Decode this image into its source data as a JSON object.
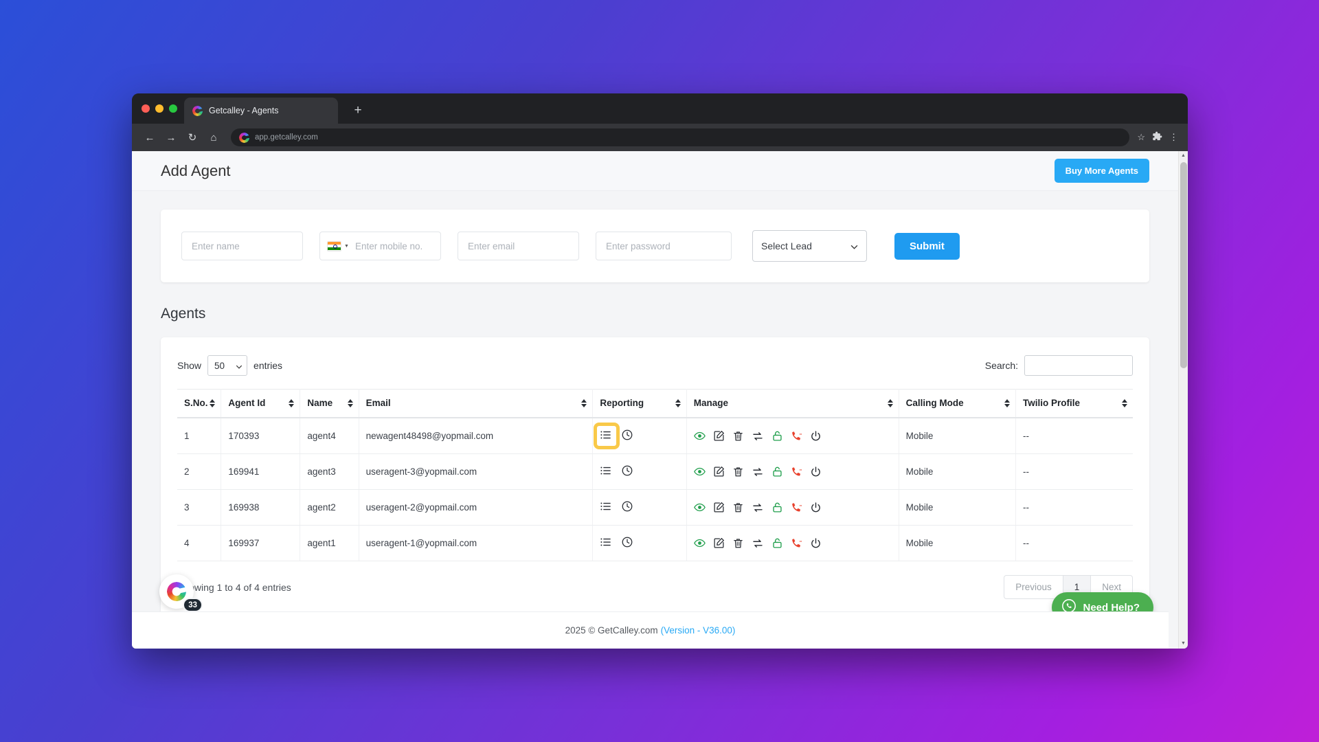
{
  "browser": {
    "tab_title": "Getcalley - Agents",
    "new_tab_label": "+",
    "url": "app.getcalley.com",
    "nav": {
      "back": "←",
      "forward": "→",
      "reload": "↻",
      "home": "⌂"
    },
    "toolbar_right": {
      "bookmark": "☆",
      "extensions": "puzzle-icon",
      "menu": "⋮"
    }
  },
  "header": {
    "title": "Add Agent",
    "buy_more_agents_label": "Buy More Agents"
  },
  "add_agent_form": {
    "name_placeholder": "Enter name",
    "mobile_placeholder": "Enter mobile no.",
    "country_flag": "india-flag-icon",
    "email_placeholder": "Enter email",
    "password_placeholder": "Enter password",
    "lead_select_value": "Select Lead",
    "submit_label": "Submit"
  },
  "agents_section": {
    "heading": "Agents",
    "show_label": "Show",
    "entries_value": "50",
    "entries_label": "entries",
    "search_label": "Search:",
    "search_value": "",
    "columns": [
      "S.No.",
      "Agent Id",
      "Name",
      "Email",
      "Reporting",
      "Manage",
      "Calling Mode",
      "Twilio Profile"
    ],
    "rows": [
      {
        "sno": "1",
        "agent_id": "170393",
        "name": "agent4",
        "email": "newagent48498@yopmail.com",
        "calling_mode": "Mobile",
        "twilio_profile": "--",
        "highlighted": true
      },
      {
        "sno": "2",
        "agent_id": "169941",
        "name": "agent3",
        "email": "useragent-3@yopmail.com",
        "calling_mode": "Mobile",
        "twilio_profile": "--",
        "highlighted": false
      },
      {
        "sno": "3",
        "agent_id": "169938",
        "name": "agent2",
        "email": "useragent-2@yopmail.com",
        "calling_mode": "Mobile",
        "twilio_profile": "--",
        "highlighted": false
      },
      {
        "sno": "4",
        "agent_id": "169937",
        "name": "agent1",
        "email": "useragent-1@yopmail.com",
        "calling_mode": "Mobile",
        "twilio_profile": "--",
        "highlighted": false
      }
    ],
    "reporting_icons": [
      "list-icon",
      "clock-icon"
    ],
    "manage_icons": [
      "eye-icon",
      "edit-icon",
      "trash-icon",
      "transfer-icon",
      "lock-icon",
      "phone-icon",
      "power-icon"
    ],
    "showing_entries": "Showing 1 to 4 of 4 entries",
    "pagination": {
      "previous_label": "Previous",
      "current_page": "1",
      "next_label": "Next"
    }
  },
  "widgets": {
    "calley_badge_count": "33",
    "calley_logo": "calley-logo-icon",
    "need_help_label": "Need Help?",
    "whatsapp_icon": "whatsapp-icon"
  },
  "footer": {
    "copyright": "2025 © GetCalley.com",
    "version": "(Version - V36.00)"
  },
  "colors": {
    "accent_blue": "#28a9f5",
    "submit_blue": "#1f9bf0",
    "highlight_yellow": "#f9c949",
    "whatsapp_green": "#4caf50",
    "icon_green": "#1f9e4b",
    "icon_red": "#e8412d"
  }
}
